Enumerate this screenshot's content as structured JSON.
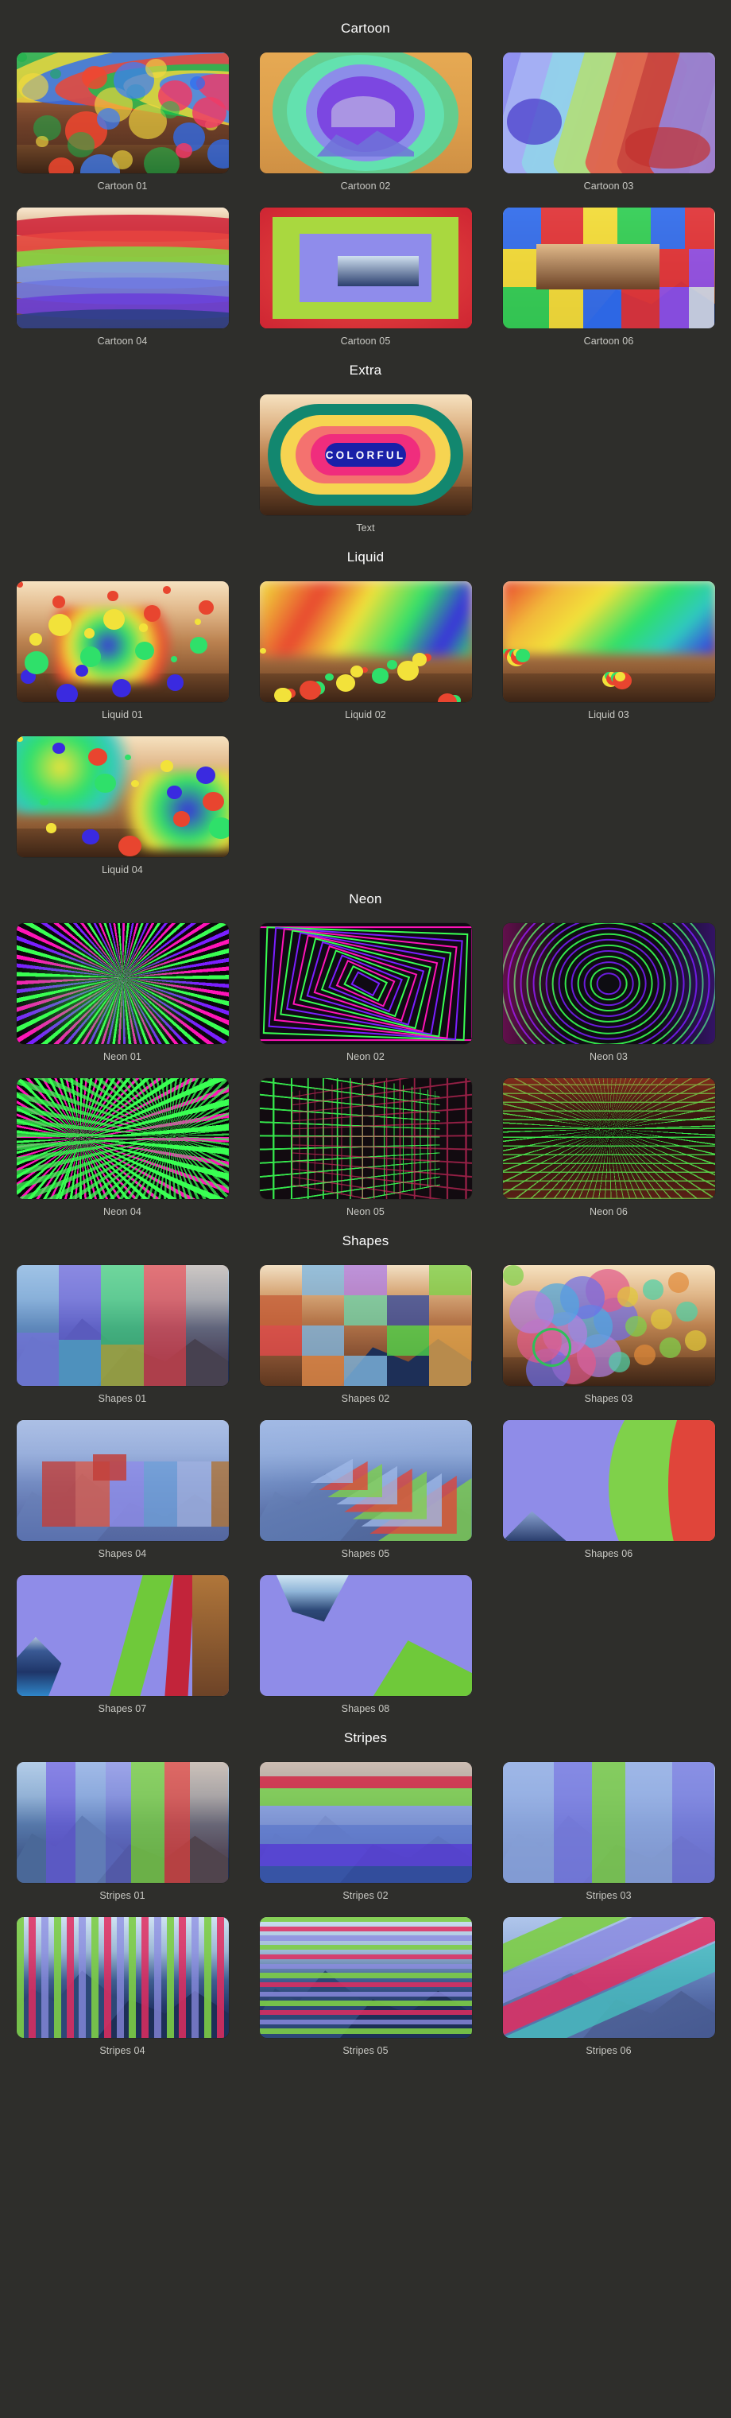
{
  "theme": {
    "background": "#2e2e2b",
    "section_title_color": "#ffffff",
    "caption_color": "#c9c9c4"
  },
  "sections": [
    {
      "title": "Cartoon",
      "items": [
        {
          "label": "Cartoon 01",
          "style": "cartoon-01"
        },
        {
          "label": "Cartoon 02",
          "style": "cartoon-02"
        },
        {
          "label": "Cartoon 03",
          "style": "cartoon-03"
        },
        {
          "label": "Cartoon 04",
          "style": "cartoon-04"
        },
        {
          "label": "Cartoon 05",
          "style": "cartoon-05"
        },
        {
          "label": "Cartoon 06",
          "style": "cartoon-06"
        }
      ]
    },
    {
      "title": "Extra",
      "items": [
        {
          "label": "Text",
          "style": "extra-text",
          "badge_text": "COLORFUL"
        }
      ]
    },
    {
      "title": "Liquid",
      "items": [
        {
          "label": "Liquid 01",
          "style": "liquid-01"
        },
        {
          "label": "Liquid 02",
          "style": "liquid-02"
        },
        {
          "label": "Liquid 03",
          "style": "liquid-03"
        },
        {
          "label": "Liquid 04",
          "style": "liquid-04"
        }
      ]
    },
    {
      "title": "Neon",
      "items": [
        {
          "label": "Neon 01",
          "style": "neon-01"
        },
        {
          "label": "Neon 02",
          "style": "neon-02"
        },
        {
          "label": "Neon 03",
          "style": "neon-03"
        },
        {
          "label": "Neon 04",
          "style": "neon-04"
        },
        {
          "label": "Neon 05",
          "style": "neon-05"
        },
        {
          "label": "Neon 06",
          "style": "neon-06"
        }
      ]
    },
    {
      "title": "Shapes",
      "items": [
        {
          "label": "Shapes 01",
          "style": "shapes-01"
        },
        {
          "label": "Shapes 02",
          "style": "shapes-02"
        },
        {
          "label": "Shapes 03",
          "style": "shapes-03"
        },
        {
          "label": "Shapes 04",
          "style": "shapes-04"
        },
        {
          "label": "Shapes 05",
          "style": "shapes-05"
        },
        {
          "label": "Shapes 06",
          "style": "shapes-06"
        },
        {
          "label": "Shapes 07",
          "style": "shapes-07"
        },
        {
          "label": "Shapes 08",
          "style": "shapes-08"
        }
      ]
    },
    {
      "title": "Stripes",
      "items": [
        {
          "label": "Stripes 01",
          "style": "stripes-01"
        },
        {
          "label": "Stripes 02",
          "style": "stripes-02"
        },
        {
          "label": "Stripes 03",
          "style": "stripes-03"
        },
        {
          "label": "Stripes 04",
          "style": "stripes-04"
        },
        {
          "label": "Stripes 05",
          "style": "stripes-05"
        },
        {
          "label": "Stripes 06",
          "style": "stripes-06"
        }
      ]
    }
  ]
}
